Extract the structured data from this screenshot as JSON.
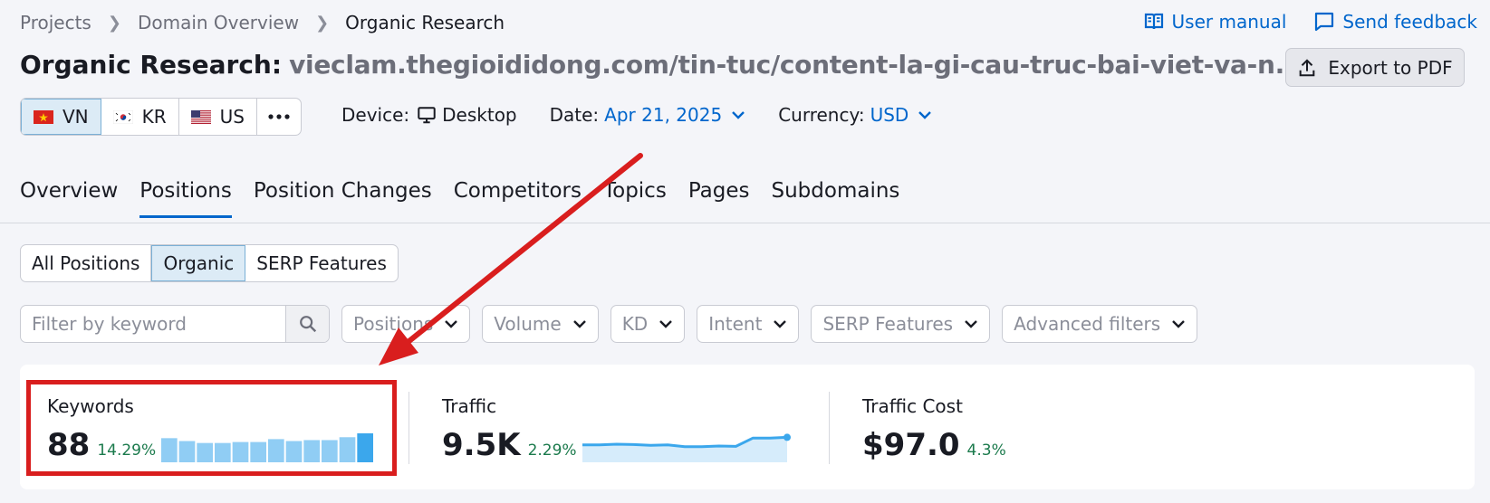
{
  "breadcrumb": {
    "items": [
      "Projects",
      "Domain Overview"
    ],
    "current": "Organic Research"
  },
  "top_links": {
    "user_manual": "User manual",
    "send_feedback": "Send feedback"
  },
  "title": {
    "label": "Organic Research:",
    "domain": "vieclam.thegioididong.com/tin-tuc/content-la-gi-cau-truc-bai-viet-va-n..."
  },
  "export_button": "Export to PDF",
  "databases": [
    {
      "code": "VN",
      "active": true
    },
    {
      "code": "KR",
      "active": false
    },
    {
      "code": "US",
      "active": false
    }
  ],
  "more_icon": "more-dots-icon",
  "device": {
    "label": "Device:",
    "value": "Desktop"
  },
  "date": {
    "label": "Date:",
    "value": "Apr 21, 2025"
  },
  "currency": {
    "label": "Currency:",
    "value": "USD"
  },
  "tabs": [
    "Overview",
    "Positions",
    "Position Changes",
    "Competitors",
    "Topics",
    "Pages",
    "Subdomains"
  ],
  "active_tab": "Positions",
  "segments": [
    "All Positions",
    "Organic",
    "SERP Features"
  ],
  "active_segment": "Organic",
  "search": {
    "placeholder": "Filter by keyword"
  },
  "filter_dropdowns": [
    "Positions",
    "Volume",
    "KD",
    "Intent",
    "SERP Features",
    "Advanced filters"
  ],
  "metrics": {
    "keywords": {
      "label": "Keywords",
      "value": "88",
      "change": "14.29%"
    },
    "traffic": {
      "label": "Traffic",
      "value": "9.5K",
      "change": "2.29%"
    },
    "traffic_cost": {
      "label": "Traffic Cost",
      "value": "$97.0",
      "change": "4.3%"
    }
  },
  "colors": {
    "accent": "#0066cc",
    "positive": "#1b7a4c",
    "highlight": "#d91e1e",
    "bar": "#90cdf4",
    "bar_last": "#3ba7ec"
  },
  "chart_data": [
    {
      "type": "bar",
      "name": "keywords-sparkline",
      "values": [
        25,
        22,
        20,
        20,
        21,
        21,
        24,
        22,
        23,
        23,
        26,
        30
      ]
    },
    {
      "type": "area",
      "name": "traffic-sparkline",
      "values": [
        48,
        48,
        50,
        49,
        47,
        48,
        43,
        43,
        45,
        44,
        67,
        67,
        69
      ]
    }
  ]
}
